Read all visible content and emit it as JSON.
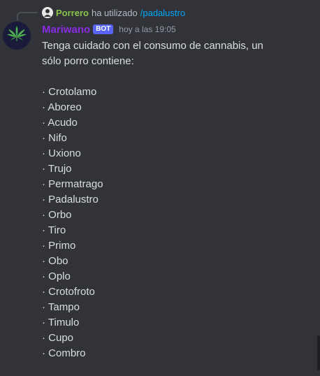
{
  "reply": {
    "user": "Porrero",
    "text": "ha utilizado",
    "command": "/padalustro"
  },
  "author": {
    "name": "Mariwano",
    "badge": "BOT",
    "timestamp": "hoy a las 19:05",
    "avatar_icon": "cannabis-leaf-icon"
  },
  "message": {
    "intro_line1": "Tenga cuidado con el consumo de cannabis, un",
    "intro_line2": "sólo porro contiene:",
    "items": [
      "· Crotolamo",
      "· Aboreo",
      "· Acudo",
      "· Nifo",
      "· Uxiono",
      "· Trujo",
      "· Permatrago",
      "· Padalustro",
      "· Orbo",
      "· Tiro",
      "· Primo",
      "· Obo",
      "· Oplo",
      "· Crotofroto",
      "· Tampo",
      "· Timulo",
      "· Cupo",
      "· Combro"
    ]
  },
  "colors": {
    "background": "#313338",
    "username": "#8a2be2",
    "reply_user": "#8bc34a",
    "command": "#00a8fc",
    "badge": "#5865f2",
    "leaf": "#4caf50"
  }
}
